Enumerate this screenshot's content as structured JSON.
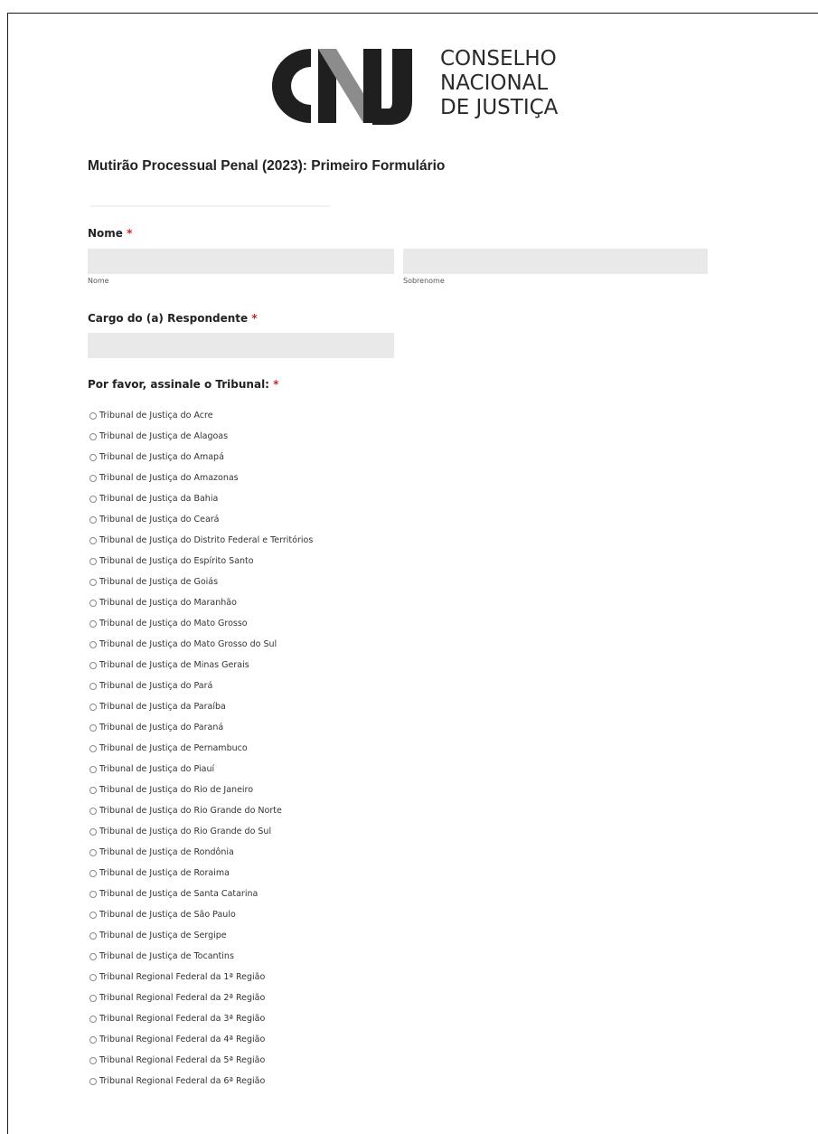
{
  "header": {
    "logo_text": "CNJ",
    "org_lines": [
      "CONSELHO",
      "NACIONAL",
      "DE JUSTIÇA"
    ]
  },
  "form": {
    "title": "Mutirão Processual Penal (2023): Primeiro Formulário",
    "required_marker": "*",
    "name_field": {
      "label": "Nome",
      "first_sublabel": "Nome",
      "last_sublabel": "Sobrenome",
      "first_value": "",
      "last_value": ""
    },
    "role_field": {
      "label": "Cargo do (a) Respondente",
      "value": ""
    },
    "court_field": {
      "label": "Por favor, assinale o Tribunal:",
      "options": [
        "Tribunal de Justiça do Acre",
        "Tribunal de Justiça de Alagoas",
        "Tribunal de Justiça do Amapá",
        "Tribunal de Justiça do Amazonas",
        "Tribunal de Justiça da Bahia",
        "Tribunal de Justiça do Ceará",
        "Tribunal de Justiça do Distrito Federal e Territórios",
        "Tribunal de Justiça do Espírito Santo",
        "Tribunal de Justiça de Goiás",
        "Tribunal de Justiça do Maranhão",
        "Tribunal de Justiça do Mato Grosso",
        "Tribunal de Justiça do Mato Grosso do Sul",
        "Tribunal de Justiça de Minas Gerais",
        "Tribunal de Justiça do Pará",
        "Tribunal de Justiça da Paraíba",
        "Tribunal de Justiça do Paraná",
        "Tribunal de Justiça de Pernambuco",
        "Tribunal de Justiça do Piauí",
        "Tribunal de Justiça do Rio de Janeiro",
        "Tribunal de Justiça do Rio Grande do Norte",
        "Tribunal de Justiça do Rio Grande do Sul",
        "Tribunal de Justiça de Rondônia",
        "Tribunal de Justiça de Roraima",
        "Tribunal de Justiça de Santa Catarina",
        "Tribunal de Justiça de São Paulo",
        "Tribunal de Justiça de Sergipe",
        "Tribunal de Justiça de Tocantins",
        "Tribunal Regional Federal da 1ª Região",
        "Tribunal Regional Federal da 2ª Região",
        "Tribunal Regional Federal da 3ª Região",
        "Tribunal Regional Federal da 4ª Região",
        "Tribunal Regional Federal da 5ª Região",
        "Tribunal Regional Federal da 6ª Região"
      ]
    }
  },
  "colors": {
    "required_star": "#c62828",
    "input_background": "#e9e9e9",
    "logo_dark": "#1f1f1f",
    "logo_gray": "#8c8c8c"
  }
}
